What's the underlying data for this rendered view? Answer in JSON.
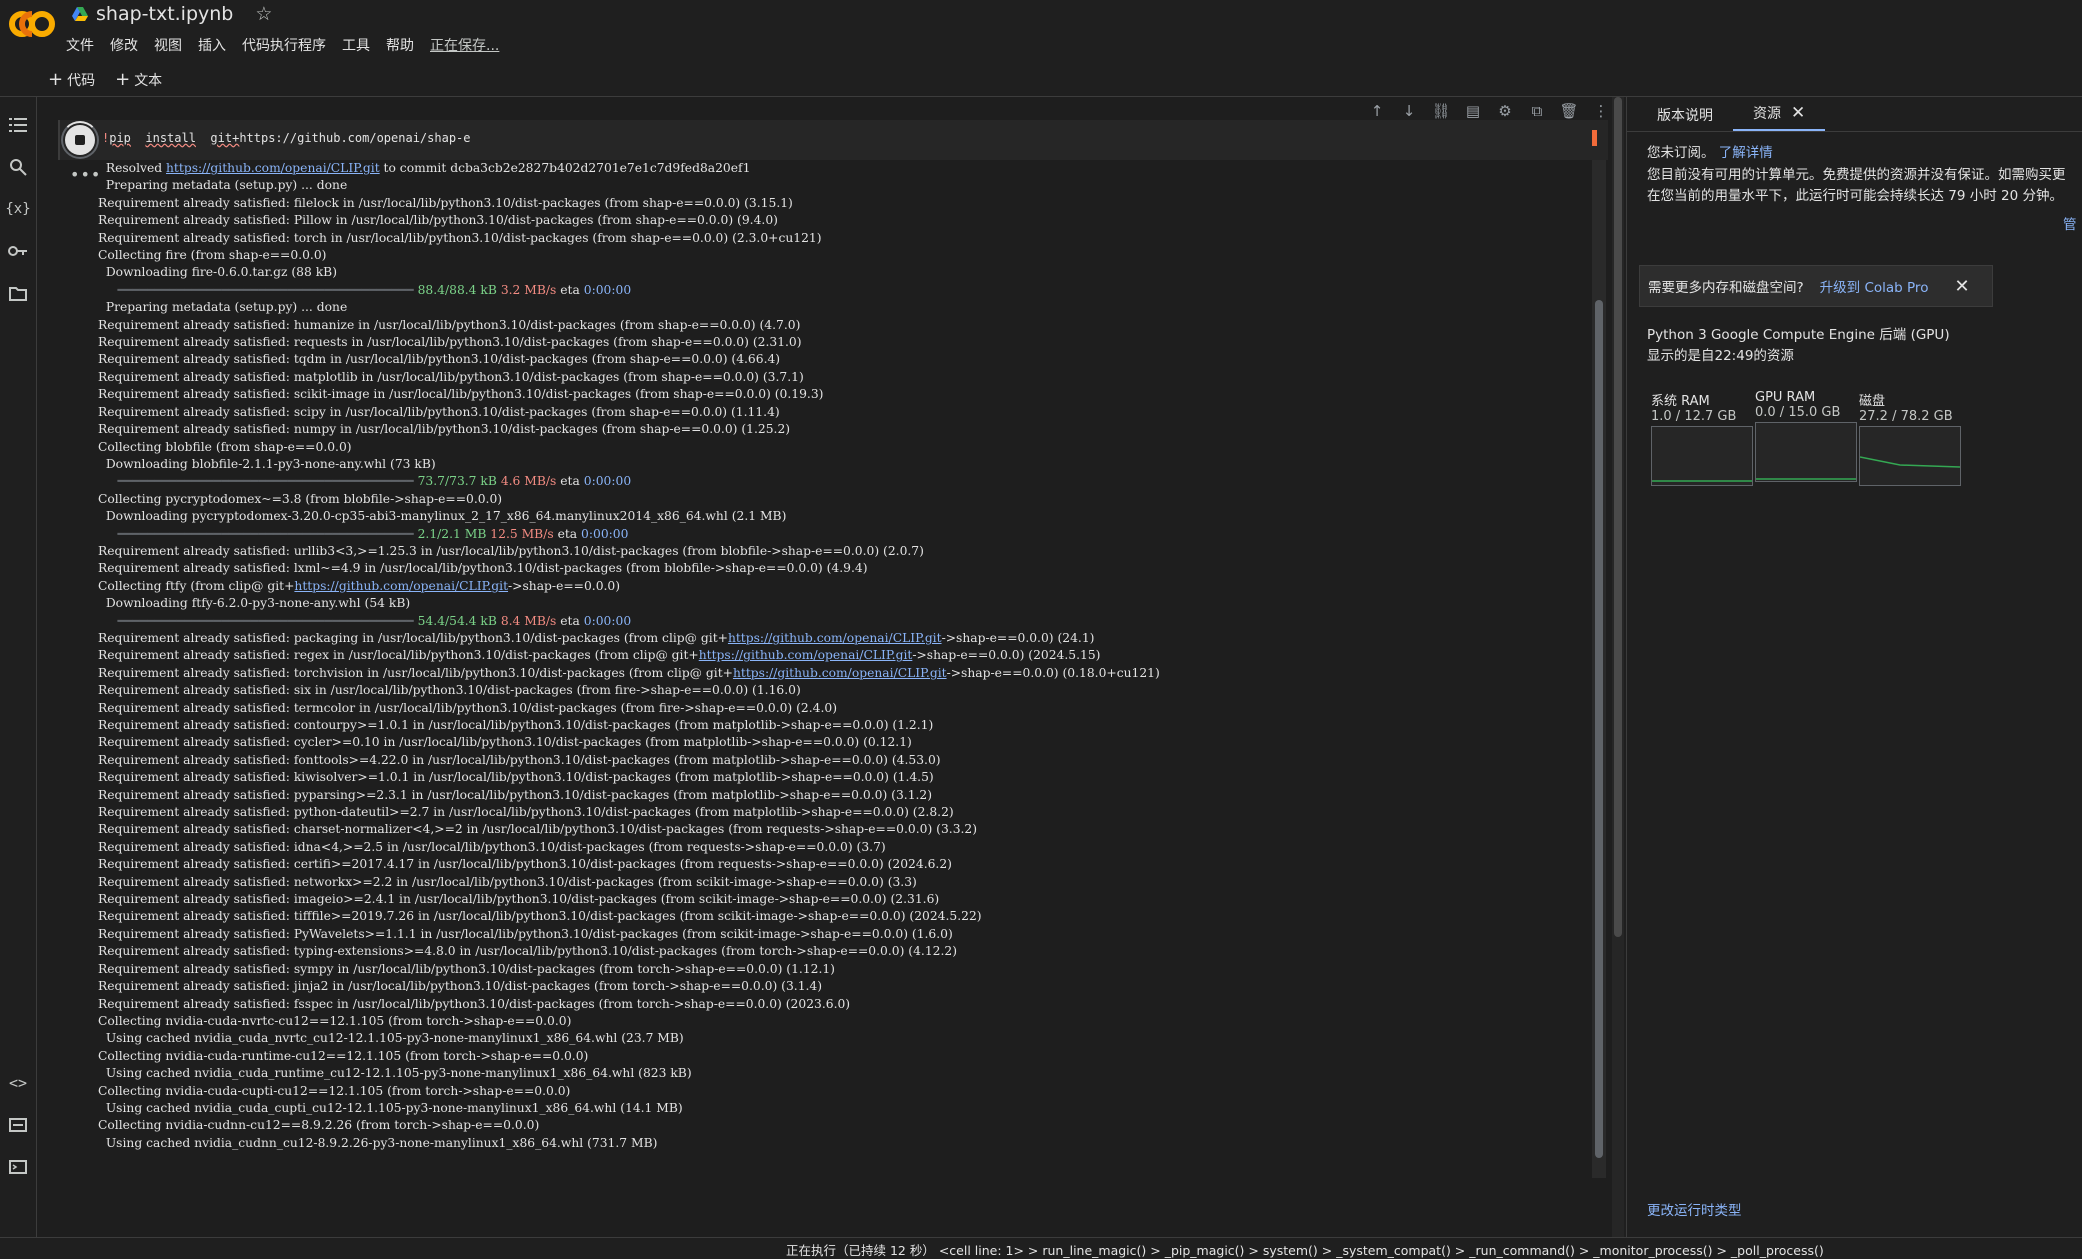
{
  "app": {
    "file_name": "shap-txt.ipynb",
    "star_icon": "star-icon",
    "brand_colors": {
      "orange": "#f9ab00",
      "accent": "#8ab4f8"
    }
  },
  "menu": {
    "items": [
      "文件",
      "修改",
      "视图",
      "插入",
      "代码执行程序",
      "工具",
      "帮助"
    ],
    "saving_status": "正在保存..."
  },
  "toolbar": {
    "add_code": "代码",
    "add_text": "文本"
  },
  "cell": {
    "code": {
      "cmd1": "pip",
      "cmd2": "install",
      "cmd3": "git+",
      "url": "https://github.com/openai/shap-e"
    },
    "ellipsis": "•••",
    "output_lines": [
      {
        "t": "  Resolved ",
        "a": "https://github.com/openai/CLIP.git",
        "r": " to commit dcba3cb2e2827b402d2701e7e1c7d9fed8a20ef1"
      },
      {
        "t": "  Preparing metadata (setup.py) ... done"
      },
      {
        "t": "Requirement already satisfied: filelock in /usr/local/lib/python3.10/dist-packages (from shap-e==0.0.0) (3.15.1)"
      },
      {
        "t": "Requirement already satisfied: Pillow in /usr/local/lib/python3.10/dist-packages (from shap-e==0.0.0) (9.4.0)"
      },
      {
        "t": "Requirement already satisfied: torch in /usr/local/lib/python3.10/dist-packages (from shap-e==0.0.0) (2.3.0+cu121)"
      },
      {
        "t": "Collecting fire (from shap-e==0.0.0)"
      },
      {
        "t": "  Downloading fire-0.6.0.tar.gz (88 kB)"
      },
      {
        "p": "     ━━━━━━━━━━━━━━━━━━━━━━━━━━━━━━━━━━━━━━━━ ",
        "g": "88.4/88.4 kB",
        "rr": " 3.2 MB/s",
        "e": " eta ",
        "c": "0:00:00"
      },
      {
        "t": "  Preparing metadata (setup.py) ... done"
      },
      {
        "t": "Requirement already satisfied: humanize in /usr/local/lib/python3.10/dist-packages (from shap-e==0.0.0) (4.7.0)"
      },
      {
        "t": "Requirement already satisfied: requests in /usr/local/lib/python3.10/dist-packages (from shap-e==0.0.0) (2.31.0)"
      },
      {
        "t": "Requirement already satisfied: tqdm in /usr/local/lib/python3.10/dist-packages (from shap-e==0.0.0) (4.66.4)"
      },
      {
        "t": "Requirement already satisfied: matplotlib in /usr/local/lib/python3.10/dist-packages (from shap-e==0.0.0) (3.7.1)"
      },
      {
        "t": "Requirement already satisfied: scikit-image in /usr/local/lib/python3.10/dist-packages (from shap-e==0.0.0) (0.19.3)"
      },
      {
        "t": "Requirement already satisfied: scipy in /usr/local/lib/python3.10/dist-packages (from shap-e==0.0.0) (1.11.4)"
      },
      {
        "t": "Requirement already satisfied: numpy in /usr/local/lib/python3.10/dist-packages (from shap-e==0.0.0) (1.25.2)"
      },
      {
        "t": "Collecting blobfile (from shap-e==0.0.0)"
      },
      {
        "t": "  Downloading blobfile-2.1.1-py3-none-any.whl (73 kB)"
      },
      {
        "p": "     ━━━━━━━━━━━━━━━━━━━━━━━━━━━━━━━━━━━━━━━━ ",
        "g": "73.7/73.7 kB",
        "rr": " 4.6 MB/s",
        "e": " eta ",
        "c": "0:00:00"
      },
      {
        "t": "Collecting pycryptodomex~=3.8 (from blobfile->shap-e==0.0.0)"
      },
      {
        "t": "  Downloading pycryptodomex-3.20.0-cp35-abi3-manylinux_2_17_x86_64.manylinux2014_x86_64.whl (2.1 MB)"
      },
      {
        "p": "     ━━━━━━━━━━━━━━━━━━━━━━━━━━━━━━━━━━━━━━━━ ",
        "g": "2.1/2.1 MB",
        "rr": " 12.5 MB/s",
        "e": " eta ",
        "c": "0:00:00"
      },
      {
        "t": "Requirement already satisfied: urllib3<3,>=1.25.3 in /usr/local/lib/python3.10/dist-packages (from blobfile->shap-e==0.0.0) (2.0.7)"
      },
      {
        "t": "Requirement already satisfied: lxml~=4.9 in /usr/local/lib/python3.10/dist-packages (from blobfile->shap-e==0.0.0) (4.9.4)"
      },
      {
        "t": "Collecting ftfy (from clip@ git+",
        "a": "https://github.com/openai/CLIP.git",
        "r": "->shap-e==0.0.0)"
      },
      {
        "t": "  Downloading ftfy-6.2.0-py3-none-any.whl (54 kB)"
      },
      {
        "p": "     ━━━━━━━━━━━━━━━━━━━━━━━━━━━━━━━━━━━━━━━━ ",
        "g": "54.4/54.4 kB",
        "rr": " 8.4 MB/s",
        "e": " eta ",
        "c": "0:00:00"
      },
      {
        "t": "Requirement already satisfied: packaging in /usr/local/lib/python3.10/dist-packages (from clip@ git+",
        "a": "https://github.com/openai/CLIP.git",
        "r": "->shap-e==0.0.0) (24.1)"
      },
      {
        "t": "Requirement already satisfied: regex in /usr/local/lib/python3.10/dist-packages (from clip@ git+",
        "a": "https://github.com/openai/CLIP.git",
        "r": "->shap-e==0.0.0) (2024.5.15)"
      },
      {
        "t": "Requirement already satisfied: torchvision in /usr/local/lib/python3.10/dist-packages (from clip@ git+",
        "a": "https://github.com/openai/CLIP.git",
        "r": "->shap-e==0.0.0) (0.18.0+cu121)"
      },
      {
        "t": "Requirement already satisfied: six in /usr/local/lib/python3.10/dist-packages (from fire->shap-e==0.0.0) (1.16.0)"
      },
      {
        "t": "Requirement already satisfied: termcolor in /usr/local/lib/python3.10/dist-packages (from fire->shap-e==0.0.0) (2.4.0)"
      },
      {
        "t": "Requirement already satisfied: contourpy>=1.0.1 in /usr/local/lib/python3.10/dist-packages (from matplotlib->shap-e==0.0.0) (1.2.1)"
      },
      {
        "t": "Requirement already satisfied: cycler>=0.10 in /usr/local/lib/python3.10/dist-packages (from matplotlib->shap-e==0.0.0) (0.12.1)"
      },
      {
        "t": "Requirement already satisfied: fonttools>=4.22.0 in /usr/local/lib/python3.10/dist-packages (from matplotlib->shap-e==0.0.0) (4.53.0)"
      },
      {
        "t": "Requirement already satisfied: kiwisolver>=1.0.1 in /usr/local/lib/python3.10/dist-packages (from matplotlib->shap-e==0.0.0) (1.4.5)"
      },
      {
        "t": "Requirement already satisfied: pyparsing>=2.3.1 in /usr/local/lib/python3.10/dist-packages (from matplotlib->shap-e==0.0.0) (3.1.2)"
      },
      {
        "t": "Requirement already satisfied: python-dateutil>=2.7 in /usr/local/lib/python3.10/dist-packages (from matplotlib->shap-e==0.0.0) (2.8.2)"
      },
      {
        "t": "Requirement already satisfied: charset-normalizer<4,>=2 in /usr/local/lib/python3.10/dist-packages (from requests->shap-e==0.0.0) (3.3.2)"
      },
      {
        "t": "Requirement already satisfied: idna<4,>=2.5 in /usr/local/lib/python3.10/dist-packages (from requests->shap-e==0.0.0) (3.7)"
      },
      {
        "t": "Requirement already satisfied: certifi>=2017.4.17 in /usr/local/lib/python3.10/dist-packages (from requests->shap-e==0.0.0) (2024.6.2)"
      },
      {
        "t": "Requirement already satisfied: networkx>=2.2 in /usr/local/lib/python3.10/dist-packages (from scikit-image->shap-e==0.0.0) (3.3)"
      },
      {
        "t": "Requirement already satisfied: imageio>=2.4.1 in /usr/local/lib/python3.10/dist-packages (from scikit-image->shap-e==0.0.0) (2.31.6)"
      },
      {
        "t": "Requirement already satisfied: tifffile>=2019.7.26 in /usr/local/lib/python3.10/dist-packages (from scikit-image->shap-e==0.0.0) (2024.5.22)"
      },
      {
        "t": "Requirement already satisfied: PyWavelets>=1.1.1 in /usr/local/lib/python3.10/dist-packages (from scikit-image->shap-e==0.0.0) (1.6.0)"
      },
      {
        "t": "Requirement already satisfied: typing-extensions>=4.8.0 in /usr/local/lib/python3.10/dist-packages (from torch->shap-e==0.0.0) (4.12.2)"
      },
      {
        "t": "Requirement already satisfied: sympy in /usr/local/lib/python3.10/dist-packages (from torch->shap-e==0.0.0) (1.12.1)"
      },
      {
        "t": "Requirement already satisfied: jinja2 in /usr/local/lib/python3.10/dist-packages (from torch->shap-e==0.0.0) (3.1.4)"
      },
      {
        "t": "Requirement already satisfied: fsspec in /usr/local/lib/python3.10/dist-packages (from torch->shap-e==0.0.0) (2023.6.0)"
      },
      {
        "t": "Collecting nvidia-cuda-nvrtc-cu12==12.1.105 (from torch->shap-e==0.0.0)"
      },
      {
        "t": "  Using cached nvidia_cuda_nvrtc_cu12-12.1.105-py3-none-manylinux1_x86_64.whl (23.7 MB)"
      },
      {
        "t": "Collecting nvidia-cuda-runtime-cu12==12.1.105 (from torch->shap-e==0.0.0)"
      },
      {
        "t": "  Using cached nvidia_cuda_runtime_cu12-12.1.105-py3-none-manylinux1_x86_64.whl (823 kB)"
      },
      {
        "t": "Collecting nvidia-cuda-cupti-cu12==12.1.105 (from torch->shap-e==0.0.0)"
      },
      {
        "t": "  Using cached nvidia_cuda_cupti_cu12-12.1.105-py3-none-manylinux1_x86_64.whl (14.1 MB)"
      },
      {
        "t": "Collecting nvidia-cudnn-cu12==8.9.2.26 (from torch->shap-e==0.0.0)"
      },
      {
        "t": "  Using cached nvidia_cudnn_cu12-8.9.2.26-py3-none-manylinux1_x86_64.whl (731.7 MB)"
      }
    ]
  },
  "right_panel": {
    "tab_release_notes": "版本说明",
    "tab_resources": "资源",
    "not_subscribed": "您未订阅。",
    "learn_more": "了解详情",
    "units_line1": "您目前没有可用的计算单元。免费提供的资源并没有保证。如需购买更",
    "units_line2": "在您当前的用量水平下，此运行时可能会持续长达 79 小时 20 分钟。",
    "manage": "管",
    "upsell_q": "需要更多内存和磁盘空间?",
    "upsell_link": "升级到 Colab Pro",
    "backend": "Python 3 Google Compute Engine 后端 (GPU)",
    "since": "显示的是自22:49的资源",
    "meters": [
      {
        "label": "系统 RAM",
        "value": "1.0 / 12.7 GB",
        "used": 1.0,
        "total": 12.7
      },
      {
        "label": "GPU RAM",
        "value": "0.0 / 15.0 GB",
        "used": 0.0,
        "total": 15.0
      },
      {
        "label": "磁盘",
        "value": "27.2 / 78.2 GB",
        "used": 27.2,
        "total": 78.2
      }
    ],
    "change_runtime": "更改运行时类型"
  },
  "status": {
    "text": "正在执行（已持续 12 秒）  <cell line: 1> > run_line_magic() > _pip_magic() > system() > _system_compat() > _run_command() > _monitor_process() > _poll_process()"
  }
}
